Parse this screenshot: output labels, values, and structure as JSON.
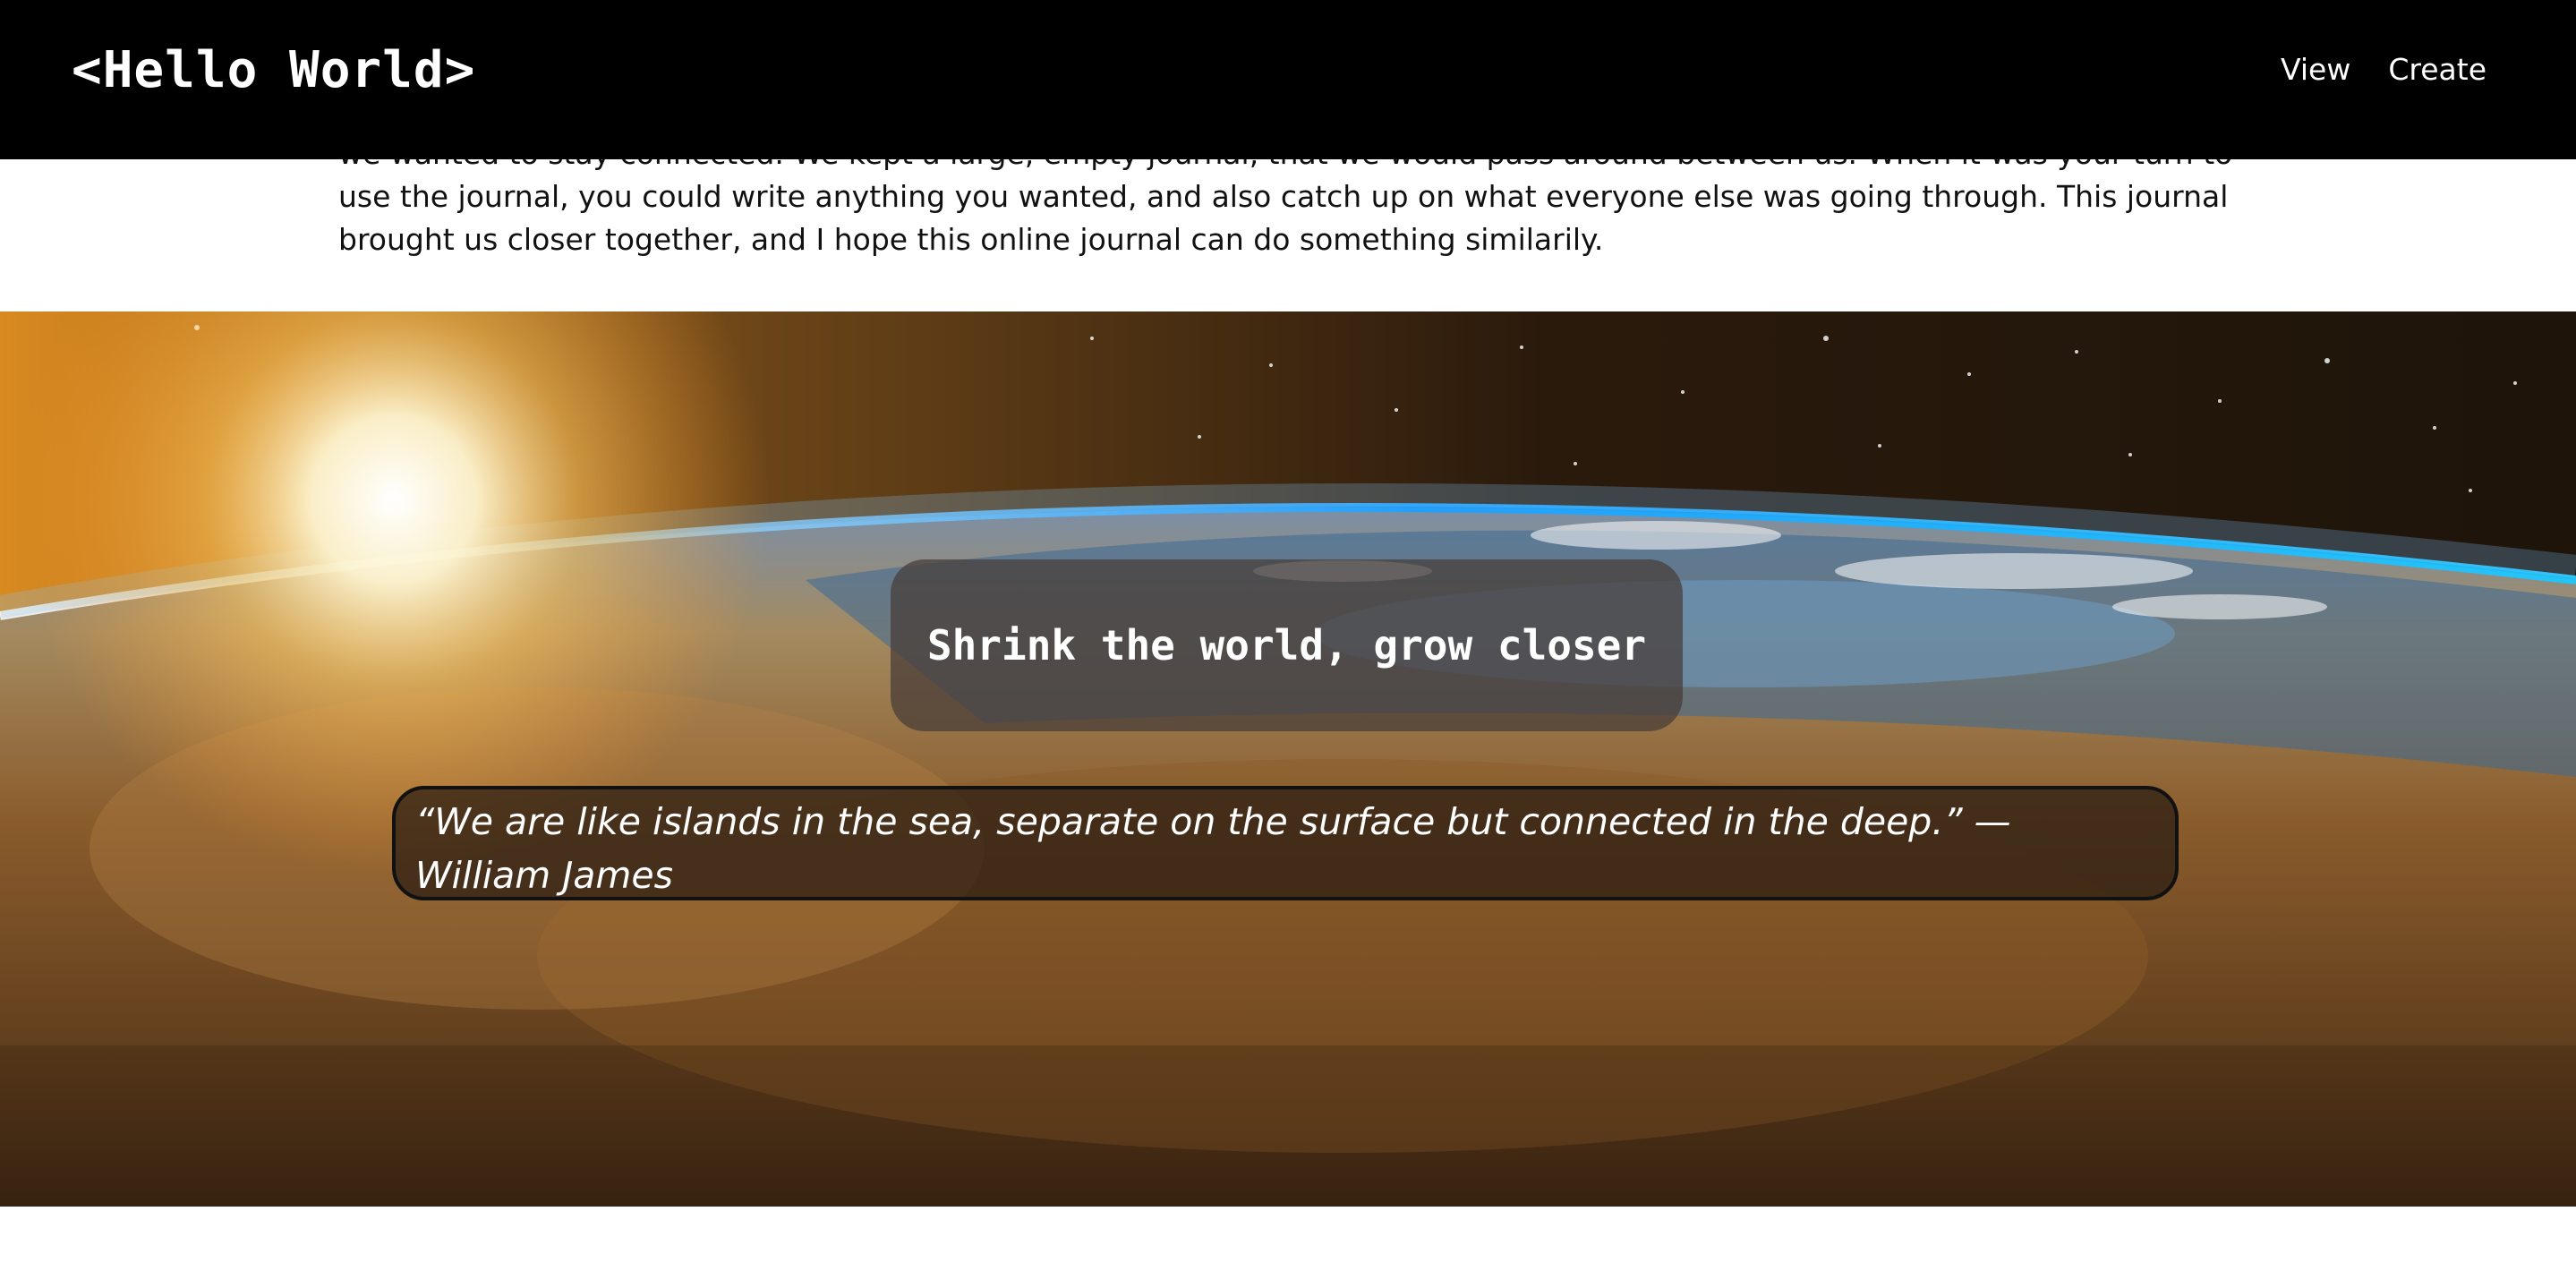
{
  "header": {
    "brand": "<Hello World>",
    "nav": [
      "View",
      "Create"
    ]
  },
  "intro": {
    "text": "we wanted to stay connected. We kept a large, empty journal, that we would pass around between us. When it was your turn to use the journal, you could write anything you wanted, and also catch up on what everyone else was going through. This journal brought us closer together, and I hope this online journal can do something similarily."
  },
  "hero": {
    "tagline": "Shrink the world, grow closer",
    "quote": "“We are like islands in the sea, separate on the surface but connected in the deep.” — William James"
  },
  "colors": {
    "header_bg": "#000000",
    "text_dark": "#111111",
    "text_light": "#ffffff",
    "atmosphere": "#1ea0ff"
  }
}
